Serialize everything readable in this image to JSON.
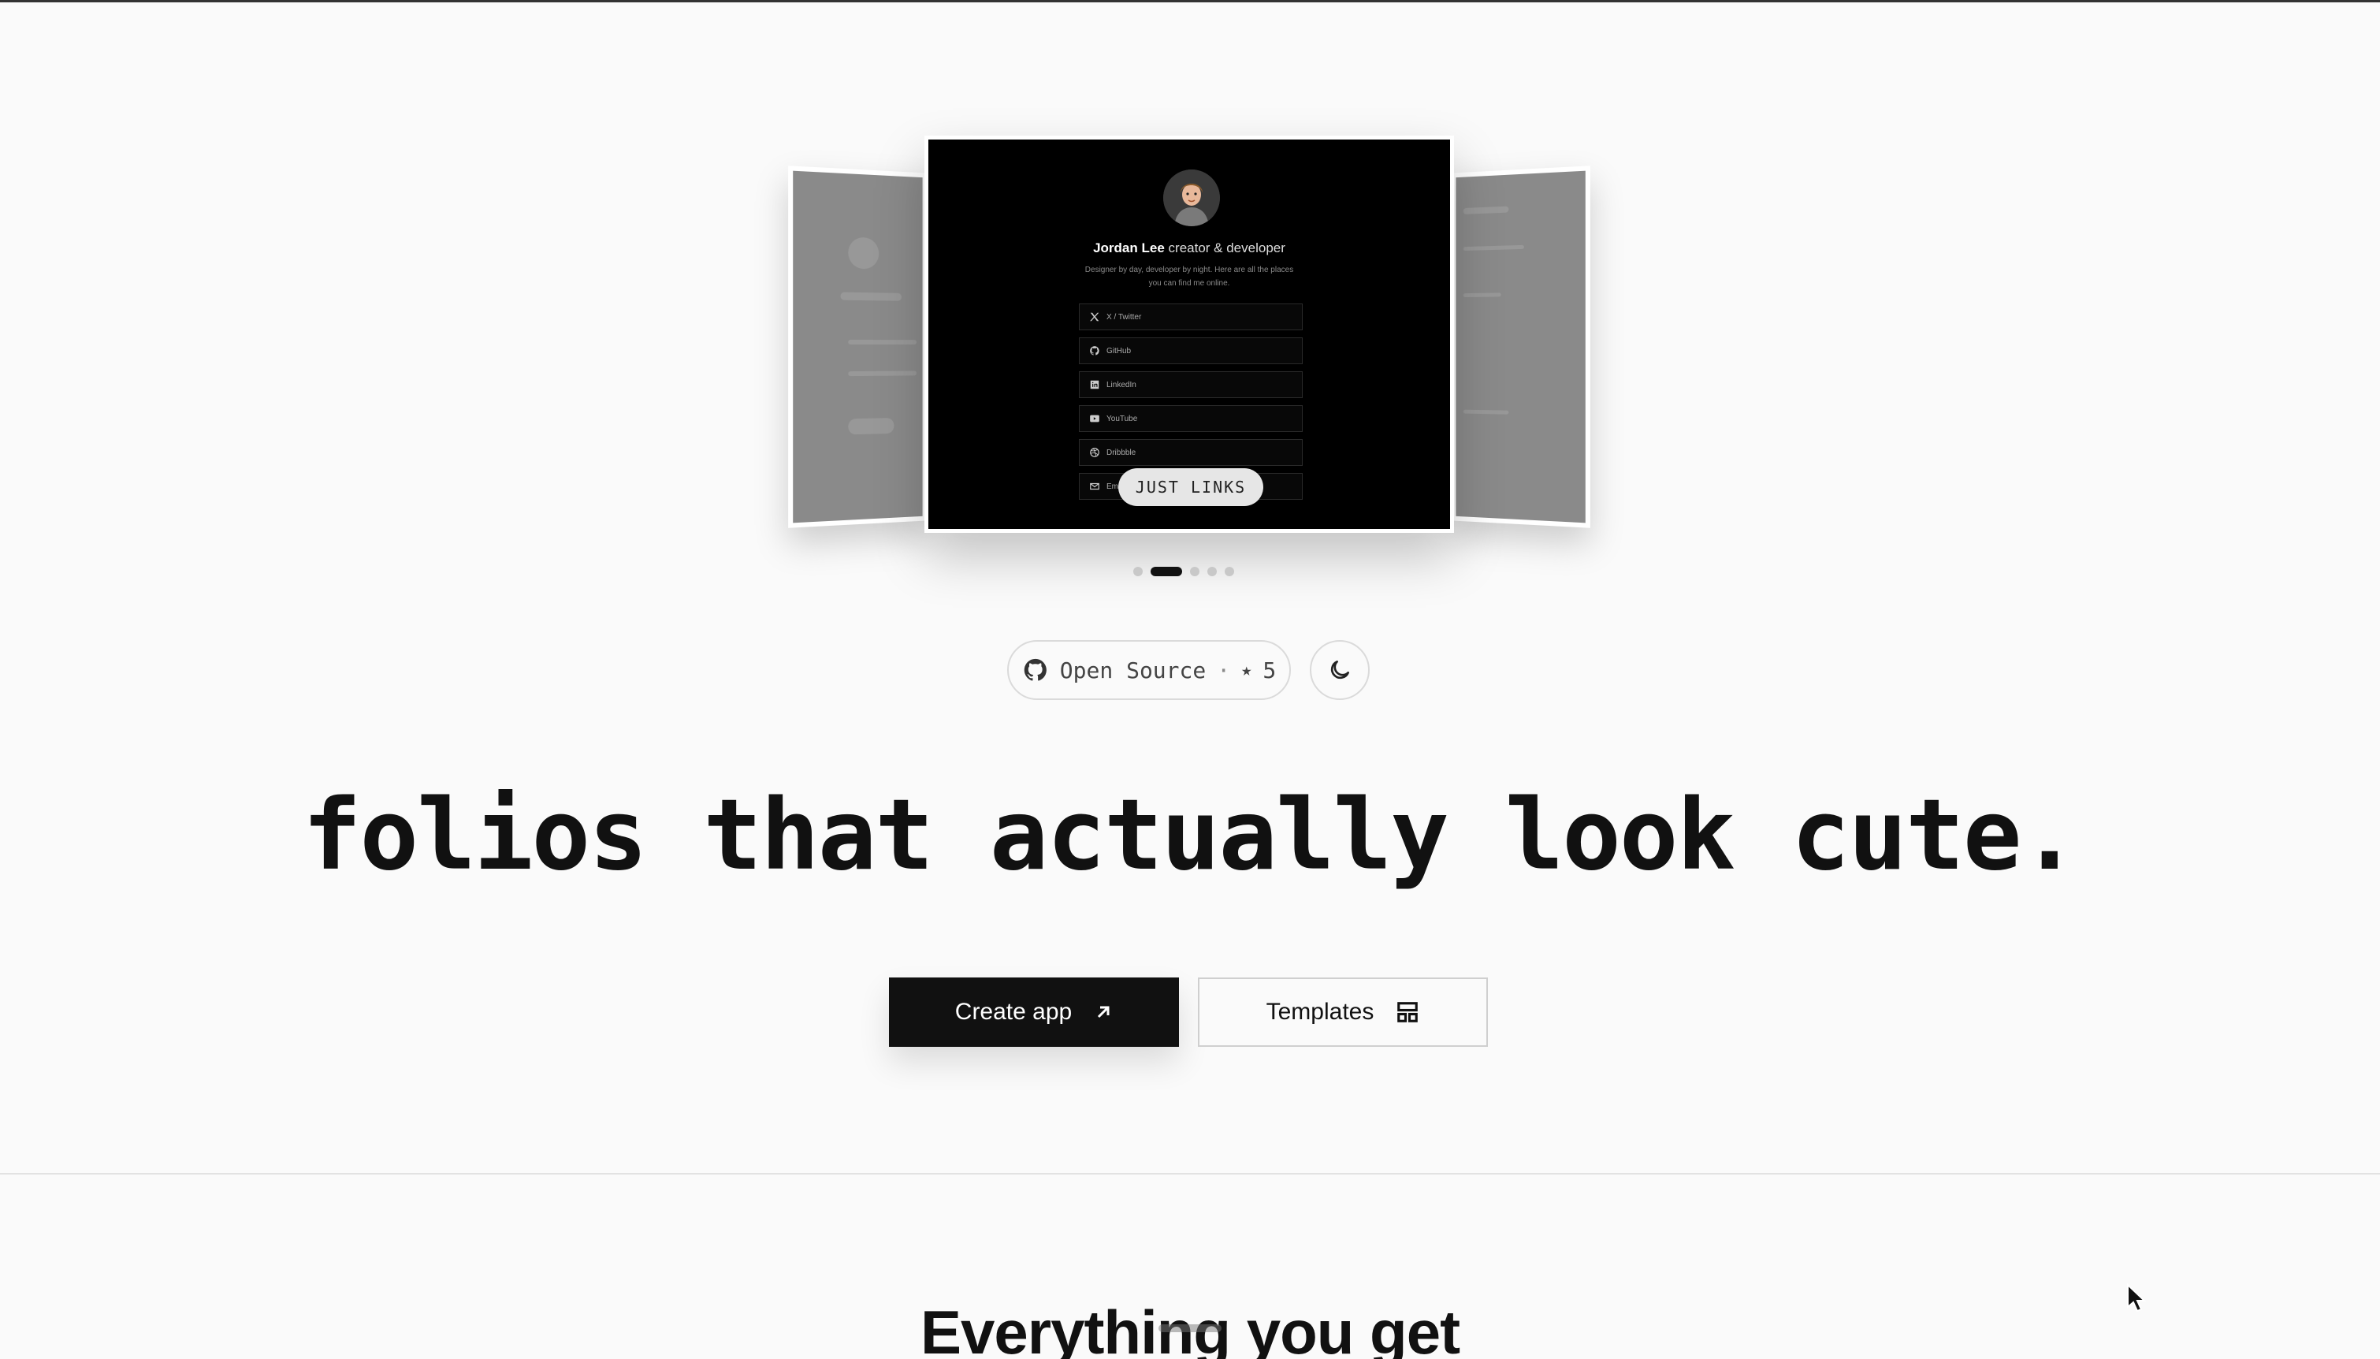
{
  "carousel": {
    "profile": {
      "name": "Jordan Lee",
      "role": "creator & developer",
      "bio": "Designer by day, developer by night. Here are all the places you can find me online."
    },
    "links": [
      {
        "label": "X / Twitter",
        "icon": "x-icon"
      },
      {
        "label": "GitHub",
        "icon": "github-icon"
      },
      {
        "label": "LinkedIn",
        "icon": "linkedin-icon"
      },
      {
        "label": "YouTube",
        "icon": "youtube-icon"
      },
      {
        "label": "Dribbble",
        "icon": "dribbble-icon"
      },
      {
        "label": "Email",
        "icon": "mail-icon"
      }
    ],
    "template_label": "JUST LINKS",
    "active_slide": 2,
    "slide_count": 5
  },
  "oss": {
    "label": "Open Source",
    "separator": "·",
    "star": "★",
    "stars": "5",
    "icon": "github-icon"
  },
  "theme_toggle": {
    "icon": "moon-icon"
  },
  "hero": {
    "headline": "folios that actually look cute."
  },
  "actions": {
    "create_label": "Create app",
    "create_icon": "arrow-up-right-icon",
    "templates_label": "Templates",
    "templates_icon": "layout-icon"
  },
  "features": {
    "title": "Everything you get"
  },
  "colors": {
    "background": "#fafafa",
    "primary": "#111111",
    "card": "#000000"
  }
}
